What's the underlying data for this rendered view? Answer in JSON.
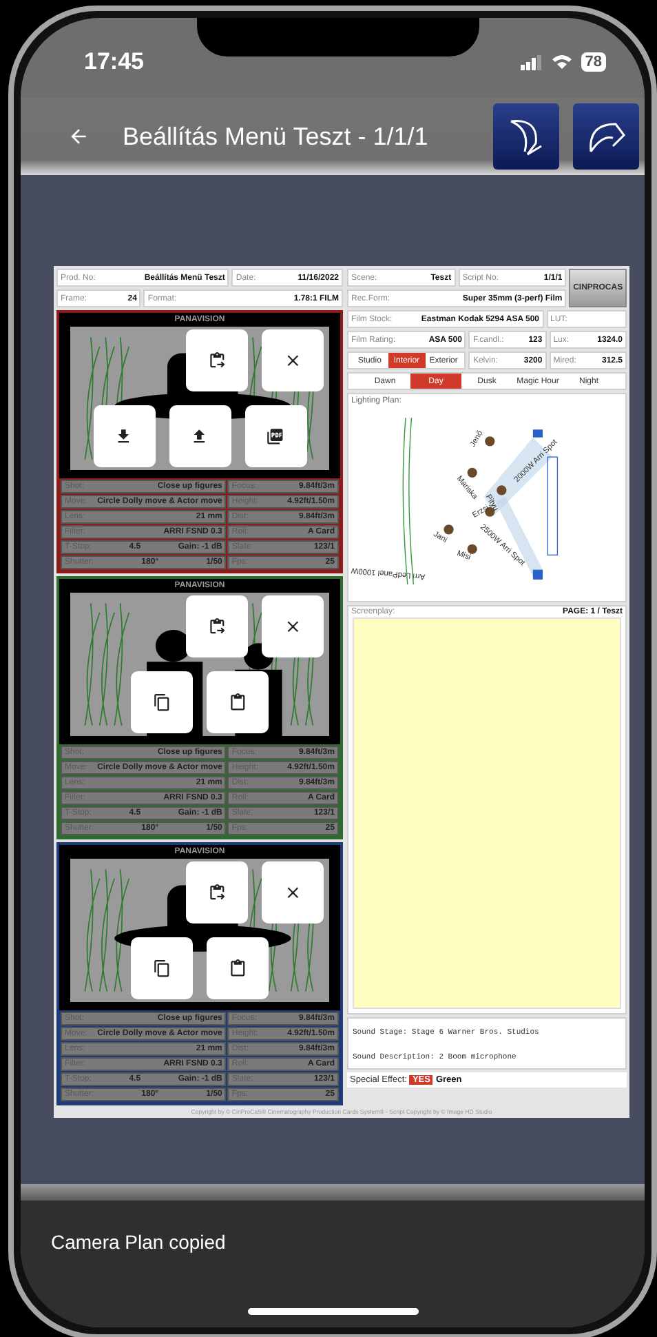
{
  "status_bar": {
    "time": "17:45",
    "battery": "78"
  },
  "app_bar": {
    "title": "Beállítás Menü Teszt - 1/1/1"
  },
  "document": {
    "info_rows": [
      [
        {
          "label": "Prod. No:",
          "value": "Beállítás Menü Teszt"
        },
        {
          "label": "Date:",
          "value": "11/16/2022"
        }
      ],
      [
        {
          "label": "Frame:",
          "value": "24"
        },
        {
          "label": "Format:",
          "value": "1.78:1 FILM"
        }
      ]
    ],
    "frames": [
      {
        "camera": "PANAVISION",
        "color": "#8b1c1c",
        "top_actions": [
          {
            "kind": "copy_to"
          },
          {
            "kind": "close"
          }
        ],
        "bottom_actions": [
          {
            "kind": "download"
          },
          {
            "kind": "upload"
          },
          {
            "kind": "pdf"
          }
        ],
        "fields": [
          {
            "label": "Shot:",
            "values": [
              "Close up figures"
            ]
          },
          {
            "label": "Focus:",
            "values": [
              "9.84ft/3m"
            ]
          },
          {
            "label": "Move:",
            "values": [
              "Circle Dolly move & Actor move"
            ]
          },
          {
            "label": "Height:",
            "values": [
              "4.92ft/1.50m"
            ]
          },
          {
            "label": "Lens:",
            "values": [
              "21 mm"
            ]
          },
          {
            "label": "Dist:",
            "values": [
              "9.84ft/3m"
            ]
          },
          {
            "label": "Filter:",
            "values": [
              "ARRI FSND 0.3"
            ]
          },
          {
            "label": "Roll:",
            "values": [
              "A Card"
            ]
          },
          {
            "label": "T-Stop:",
            "values": [
              "4.5",
              "Gain: -1 dB"
            ]
          },
          {
            "label": "Slate:",
            "values": [
              "123/1"
            ]
          },
          {
            "label": "Shutter:",
            "values": [
              "180°",
              "1/50"
            ]
          },
          {
            "label": "Fps:",
            "values": [
              "25"
            ]
          }
        ]
      },
      {
        "camera": "PANAVISION",
        "color": "#2f6b2c",
        "top_actions": [
          {
            "kind": "copy_to"
          },
          {
            "kind": "close"
          }
        ],
        "bottom_actions": [
          {
            "kind": "copy"
          },
          {
            "kind": "paste"
          }
        ],
        "fields": [
          {
            "label": "Shot:",
            "values": [
              "Close up figures"
            ]
          },
          {
            "label": "Focus:",
            "values": [
              "9.84ft/3m"
            ]
          },
          {
            "label": "Move:",
            "values": [
              "Circle Dolly move & Actor move"
            ]
          },
          {
            "label": "Height:",
            "values": [
              "4.92ft/1.50m"
            ]
          },
          {
            "label": "Lens:",
            "values": [
              "21 mm"
            ]
          },
          {
            "label": "Dist:",
            "values": [
              "9.84ft/3m"
            ]
          },
          {
            "label": "Filter:",
            "values": [
              "ARRI FSND 0.3"
            ]
          },
          {
            "label": "Roll:",
            "values": [
              "A Card"
            ]
          },
          {
            "label": "T-Stop:",
            "values": [
              "4.5",
              "Gain: -1 dB"
            ]
          },
          {
            "label": "Slate:",
            "values": [
              "123/1"
            ]
          },
          {
            "label": "Shutter:",
            "values": [
              "180°",
              "1/50"
            ]
          },
          {
            "label": "Fps:",
            "values": [
              "25"
            ]
          }
        ]
      },
      {
        "camera": "PANAVISION",
        "color": "#1f3c78",
        "top_actions": [
          {
            "kind": "copy_to"
          },
          {
            "kind": "close"
          }
        ],
        "bottom_actions": [
          {
            "kind": "copy"
          },
          {
            "kind": "paste"
          }
        ],
        "fields": [
          {
            "label": "Shot:",
            "values": [
              "Close up figures"
            ]
          },
          {
            "label": "Focus:",
            "values": [
              "9.84ft/3m"
            ]
          },
          {
            "label": "Move:",
            "values": [
              "Circle Dolly move & Actor move"
            ]
          },
          {
            "label": "Height:",
            "values": [
              "4.92ft/1.50m"
            ]
          },
          {
            "label": "Lens:",
            "values": [
              "21 mm"
            ]
          },
          {
            "label": "Dist:",
            "values": [
              "9.84ft/3m"
            ]
          },
          {
            "label": "Filter:",
            "values": [
              "ARRI FSND 0.3"
            ]
          },
          {
            "label": "Roll:",
            "values": [
              "A Card"
            ]
          },
          {
            "label": "T-Stop:",
            "values": [
              "4.5",
              "Gain: -1 dB"
            ]
          },
          {
            "label": "Slate:",
            "values": [
              "123/1"
            ]
          },
          {
            "label": "Shutter:",
            "values": [
              "180°",
              "1/50"
            ]
          },
          {
            "label": "Fps:",
            "values": [
              "25"
            ]
          }
        ]
      }
    ],
    "logo": "CINPROCAS",
    "scene_rows": [
      [
        {
          "label": "Scene:",
          "value": "Teszt"
        },
        {
          "label": "Script No:",
          "value": "1/1/1"
        }
      ],
      [
        {
          "label": "Rec.Form:",
          "value": "Super 35mm (3-perf) Film"
        }
      ],
      [
        {
          "label": "Film Stock:",
          "value": "Eastman Kodak 5294 ASA 500"
        },
        {
          "label": "LUT:"
        }
      ],
      [
        {
          "label": "Film Rating:",
          "value": "ASA 500"
        },
        {
          "label": "F.candl.:",
          "value": "123"
        },
        {
          "label": "Lux:",
          "value": "1324.0"
        }
      ]
    ],
    "location_options": [
      {
        "label": "Studio",
        "selected": false
      },
      {
        "label": "Interior",
        "selected": true
      },
      {
        "label": "Exterior",
        "selected": false
      }
    ],
    "color_fields": [
      {
        "label": "Kelvin:",
        "value": "3200"
      },
      {
        "label": "Mired:",
        "value": "312.5"
      }
    ],
    "time_of_day": [
      {
        "label": "Dawn",
        "selected": false
      },
      {
        "label": "Day",
        "selected": true
      },
      {
        "label": "Dusk",
        "selected": false
      },
      {
        "label": "Magic Hour",
        "selected": false
      },
      {
        "label": "Night",
        "selected": false
      }
    ],
    "lighting_plan": {
      "label": "Lighting Plan:",
      "people": [
        "Jenő",
        "Mariska",
        "Pityu",
        "Erzsi",
        "Jani",
        "Misi"
      ],
      "lights": [
        "2000W Arri Spot",
        "2500W Arri Spot",
        "Arri LedPanel 1000W"
      ]
    },
    "screenplay": {
      "label": "Screenplay:",
      "page": "PAGE: 1 / Teszt"
    },
    "sound": {
      "stage": "Sound Stage: Stage 6 Warner Bros. Studios",
      "description": "Sound Description: 2 Boom microphone"
    },
    "special_effect": {
      "label": "Special Effect:",
      "badge": "YES",
      "value": "Green"
    },
    "copyright": "Copyright by © CinProCaS® Cinematography Production Cards System® - Script Copyright by © Image HD Studio"
  },
  "snackbar": {
    "message": "Camera Plan copied"
  }
}
